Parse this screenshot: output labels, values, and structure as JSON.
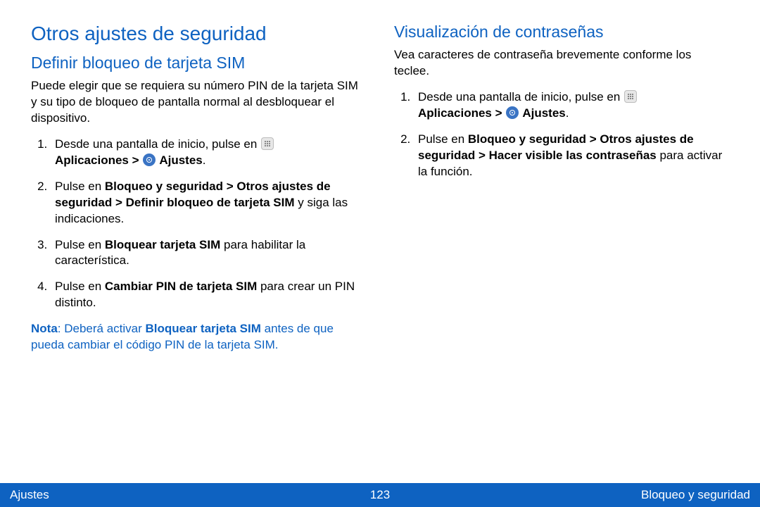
{
  "left": {
    "h1": "Otros ajustes de seguridad",
    "h2": "Definir bloqueo de tarjeta SIM",
    "intro": "Puede elegir que se requiera su número PIN de la tarjeta SIM y su tipo de bloqueo de pantalla normal al desbloquear el dispositivo.",
    "step1_a": "Desde una pantalla de inicio, pulse en ",
    "step1_b": "Aplicaciones > ",
    "step1_c": " Ajustes",
    "step1_d": ".",
    "step2_a": "Pulse en ",
    "step2_b": "Bloqueo y seguridad > Otros ajustes de seguridad > Definir bloqueo de tarjeta SIM",
    "step2_c": " y siga las indicaciones.",
    "step3_a": "Pulse en ",
    "step3_b": "Bloquear tarjeta SIM",
    "step3_c": " para habilitar la característica.",
    "step4_a": "Pulse en ",
    "step4_b": "Cambiar PIN de tarjeta SIM",
    "step4_c": " para crear un PIN distinto.",
    "note_label": "Nota",
    "note_a": ": Deberá activar ",
    "note_b": "Bloquear tarjeta SIM",
    "note_c": " antes de que pueda cambiar el código PIN de la tarjeta SIM."
  },
  "right": {
    "h2": "Visualización de contraseñas",
    "intro": "Vea caracteres de contraseña brevemente conforme los teclee.",
    "step1_a": "Desde una pantalla de inicio, pulse en ",
    "step1_b": "Aplicaciones > ",
    "step1_c": " Ajustes",
    "step1_d": ".",
    "step2_a": "Pulse en ",
    "step2_b": "Bloqueo y seguridad > Otros ajustes de seguridad > Hacer visible las contraseñas",
    "step2_c": " para activar la función."
  },
  "footer": {
    "left": "Ajustes",
    "page": "123",
    "right": "Bloqueo y seguridad"
  }
}
